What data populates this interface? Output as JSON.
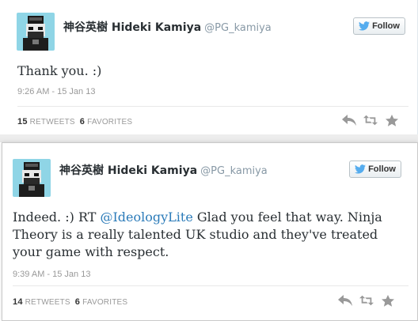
{
  "tweets": [
    {
      "name": "神谷英樹 Hideki Kamiya",
      "handle": "@PG_kamiya",
      "follow_label": "Follow",
      "text_parts": {
        "before": "Thank you. :)",
        "mention": "",
        "after": ""
      },
      "time": "9:26 AM - 15 Jan 13",
      "retweets_count": "15",
      "retweets_label": "RETWEETS",
      "favorites_count": "6",
      "favorites_label": "FAVORITES"
    },
    {
      "name": "神谷英樹 Hideki Kamiya",
      "handle": "@PG_kamiya",
      "follow_label": "Follow",
      "text_parts": {
        "before": "Indeed. :) RT ",
        "mention": "@IdeologyLite",
        "after": " Glad you feel that way. Ninja Theory is a really talented UK studio and they've treated your game with respect."
      },
      "time": "9:39 AM - 15 Jan 13",
      "retweets_count": "14",
      "retweets_label": "RETWEETS",
      "favorites_count": "6",
      "favorites_label": "FAVORITES"
    }
  ],
  "icons": {
    "follow": "twitter-bird-icon",
    "reply": "reply-icon",
    "retweet": "retweet-icon",
    "favorite": "star-icon"
  },
  "colors": {
    "mention": "#2b7bb9",
    "avatar_bg": "#8fd5e6",
    "follow_bird": "#55acee"
  }
}
